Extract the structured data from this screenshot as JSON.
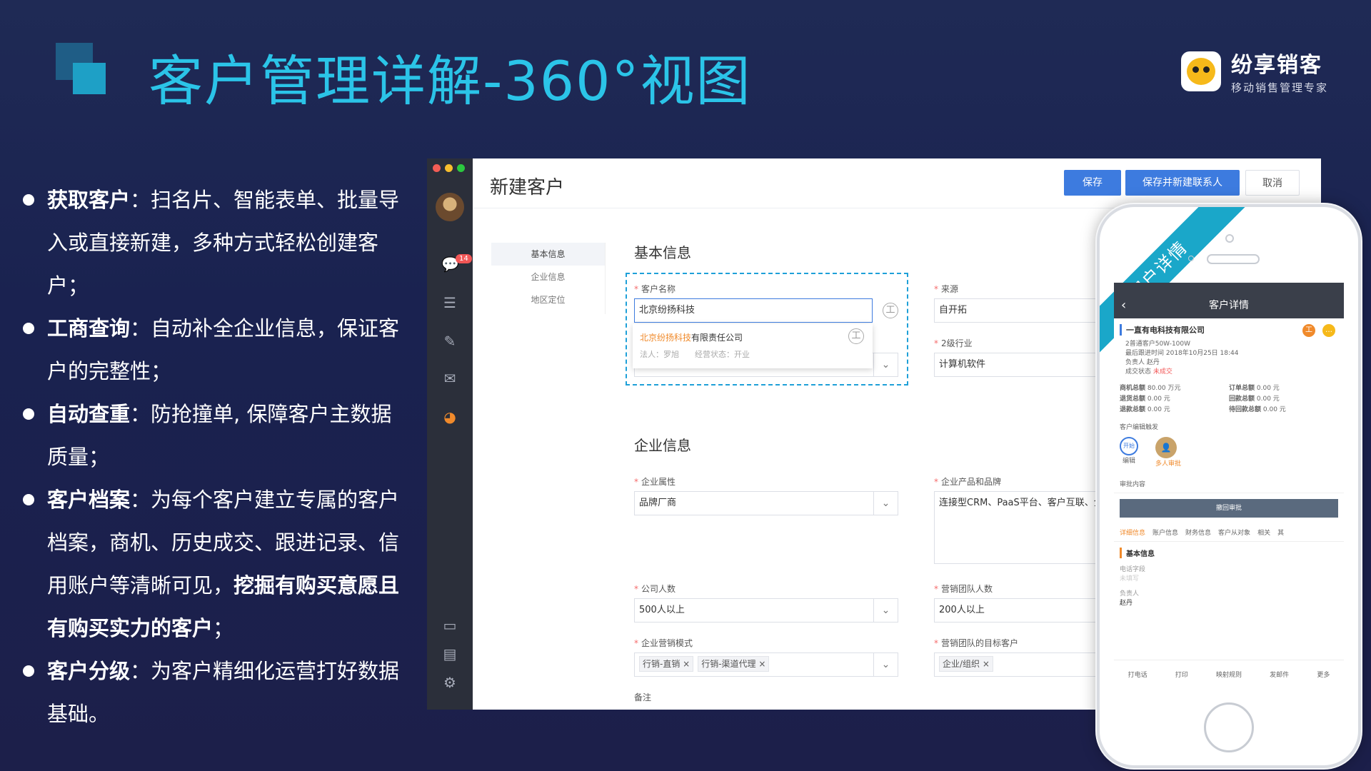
{
  "slide": {
    "title": "客户管理详解-360°视图",
    "brand_name": "纷享销客",
    "brand_slogan": "移动销售管理专家"
  },
  "bullets": [
    {
      "head": "获取客户",
      "text": "：扫名片、智能表单、批量导入或直接新建，多种方式轻松创建客户；"
    },
    {
      "head": "工商查询",
      "text": "：自动补全企业信息，保证客户的完整性；"
    },
    {
      "head": "自动查重",
      "text": "：防抢撞单, 保障客户主数据质量；"
    },
    {
      "head": "客户档案",
      "text": "：为每个客户建立专属的客户档案，商机、历史成交、跟进记录、信用账户等清晰可见，",
      "tail_bold": "挖掘有购买意愿且有购买实力的客户",
      "tail": "；"
    },
    {
      "head": "客户分级",
      "text": "：为客户精细化运营打好数据基础。"
    }
  ],
  "app": {
    "sidebar_badge": "14",
    "title": "新建客户",
    "buttons": {
      "save": "保存",
      "save_new_contact": "保存并新建联系人",
      "cancel": "取消"
    },
    "subnav": [
      "基本信息",
      "企业信息",
      "地区定位"
    ],
    "sections": {
      "basic": "基本信息",
      "company": "企业信息"
    },
    "fields": {
      "customer_name_label": "客户名称",
      "customer_name_value": "北京纷扬科技",
      "source_label": "来源",
      "source_value": "自开拓",
      "industry_label": "2级行业",
      "industry_value": "计算机软件",
      "company_attr_label": "企业属性",
      "company_attr_value": "品牌厂商",
      "products_label": "企业产品和品牌",
      "products_value": "连接型CRM、PaaS平台、客户互联、企",
      "staff_label": "公司人数",
      "staff_value": "500人以上",
      "sales_team_label": "营销团队人数",
      "sales_team_value": "200人以上",
      "marketing_mode_label": "企业营销模式",
      "marketing_mode_tags": [
        "行销-直销 ×",
        "行销-渠道代理 ×"
      ],
      "target_label": "营销团队的目标客户",
      "target_tags": [
        "企业/组织 ×"
      ],
      "remark_label": "备注"
    },
    "suggestion": {
      "name_highlight": "北京纷扬科技",
      "name_rest": "有限责任公司",
      "meta": "法人：罗旭　　经营状态：开业"
    }
  },
  "phone": {
    "ribbon": "客户详情",
    "nav_title": "客户详情",
    "company": "一直有电科技有限公司",
    "tier": "2普通客户50W-100W",
    "last_follow": "最后跟进时间  2018年10月25日 18:44",
    "owner": "负责人  赵丹",
    "deal_status_label": "成交状态",
    "deal_status": "未成交",
    "stats": [
      {
        "label": "商机总额",
        "value": "80.00 万元"
      },
      {
        "label": "订单总额",
        "value": "0.00 元"
      },
      {
        "label": "退货总额",
        "value": "0.00 元"
      },
      {
        "label": "回款总额",
        "value": "0.00 元"
      },
      {
        "label": "退款总额",
        "value": "0.00 元"
      },
      {
        "label": "待回款总额",
        "value": "0.00 元"
      }
    ],
    "flow_title": "客户编辑触发",
    "flow_start": "开始",
    "flow_edit": "编辑",
    "flow_approve": "多人审批",
    "approval_content": "审批内容",
    "withdraw_btn": "撤回审批",
    "tabs": [
      "详细信息",
      "账户信息",
      "财务信息",
      "客户从对象",
      "相关",
      "其"
    ],
    "basic_info": "基本信息",
    "phone_field": "电话字段",
    "phone_field_value": "未填写",
    "owner_field": "负责人",
    "owner_field_value": "赵丹",
    "bottom_actions": [
      "打电话",
      "打印",
      "映射规则",
      "发邮件",
      "更多"
    ]
  }
}
